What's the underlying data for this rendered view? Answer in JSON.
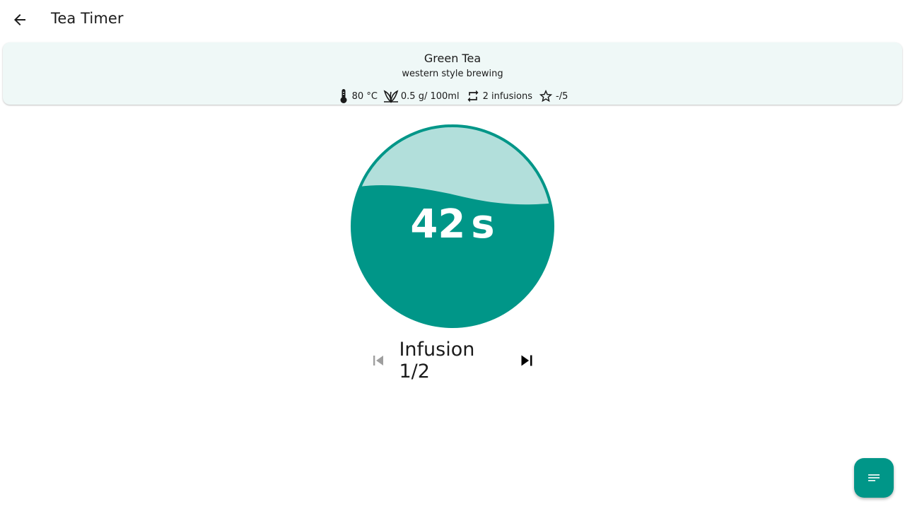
{
  "appbar": {
    "title": "Tea Timer",
    "back_icon": "arrow-back-icon"
  },
  "tea": {
    "name": "Green Tea",
    "style": "western style brewing",
    "temperature": "80 °C",
    "amount": "0.5 g/ 100ml",
    "infusions": "2 infusions",
    "rating": "-/5",
    "icons": [
      "thermometer-icon",
      "leaf-icon",
      "repeat-icon",
      "star-outline-icon"
    ]
  },
  "timer": {
    "value": "42",
    "unit": "s",
    "fill_fraction": 0.62
  },
  "infusion": {
    "label": "Infusion 1/2",
    "previous_enabled": false,
    "next_enabled": true
  },
  "fab": {
    "icon": "notes-icon"
  },
  "colors": {
    "accent": "#009688",
    "accent_light": "#b2dfdb",
    "card_bg": "#eff8f7",
    "text": "#1b1b1b",
    "disabled": "#9e9e9e"
  }
}
